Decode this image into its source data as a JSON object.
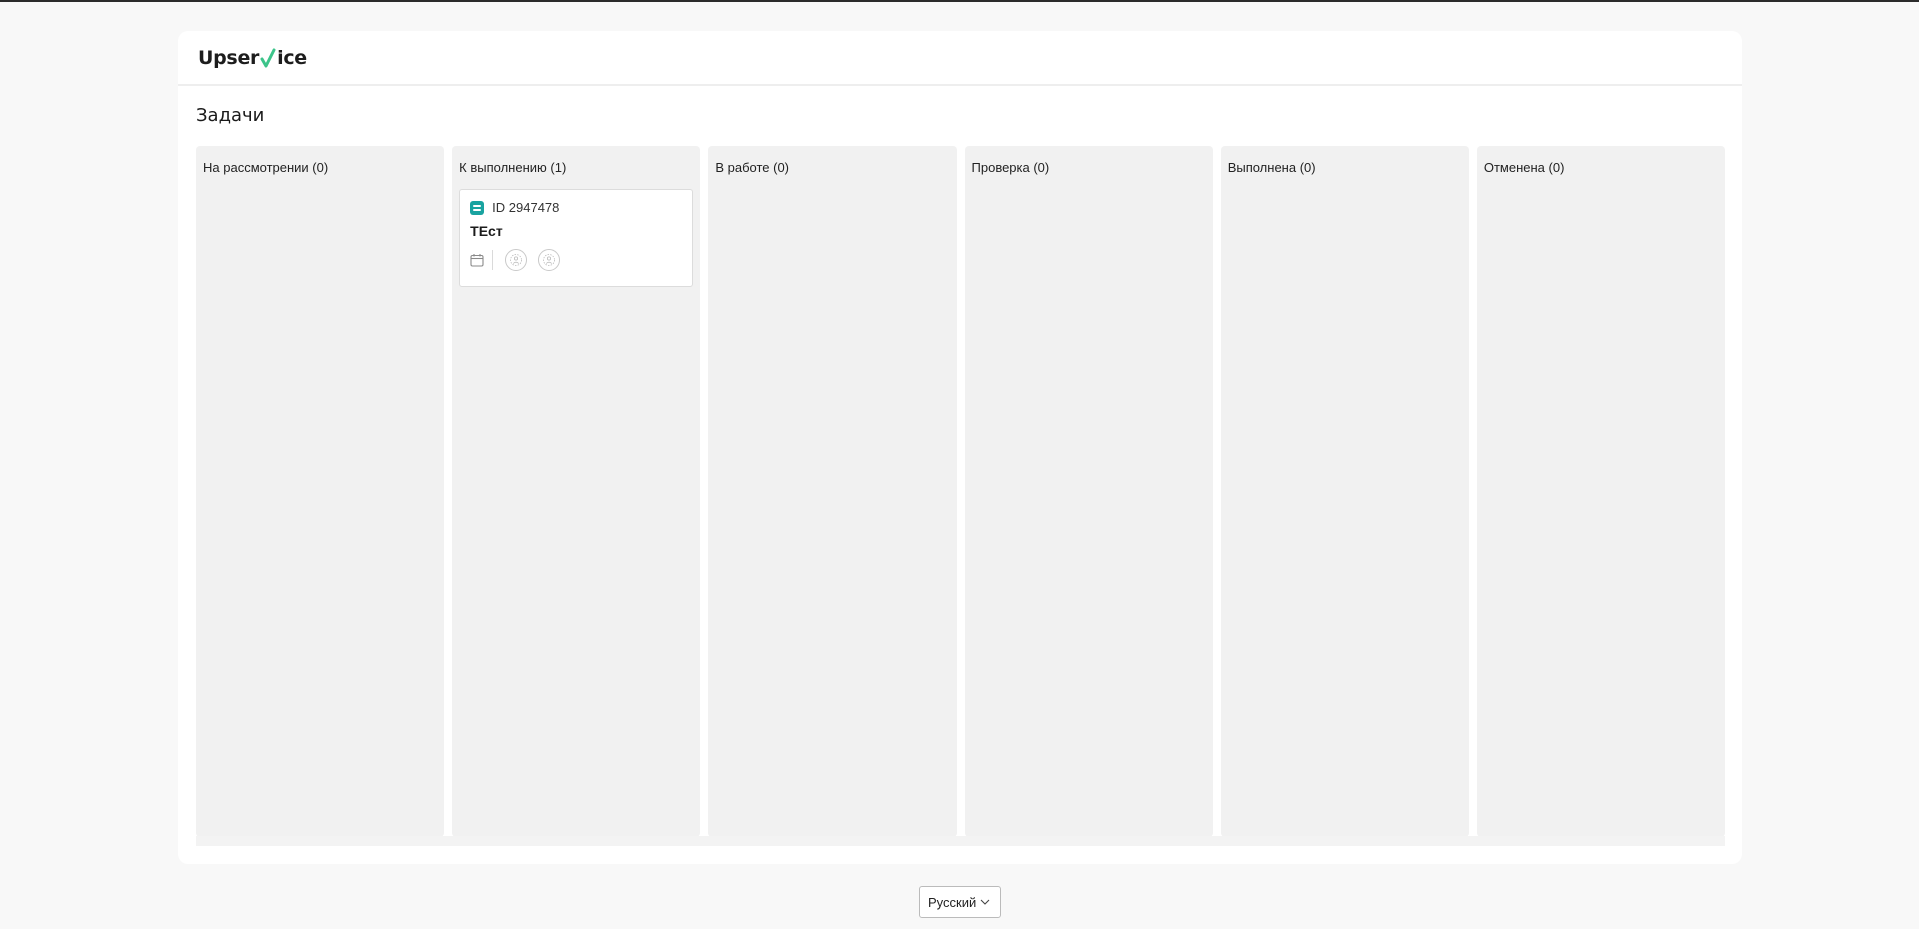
{
  "logo": {
    "part1": "Upser",
    "part2": "ice",
    "tick_color": "#3cc48a"
  },
  "page": {
    "title": "Задачи"
  },
  "columns": [
    {
      "title": "На рассмотрении (0)"
    },
    {
      "title": "К выполнению (1)"
    },
    {
      "title": "В работе (0)"
    },
    {
      "title": "Проверка (0)"
    },
    {
      "title": "Выполнена (0)"
    },
    {
      "title": "Отменена (0)"
    }
  ],
  "task": {
    "id_label": "ID 2947478",
    "title": "ТЕст",
    "type_icon": "task-list-icon",
    "date_icon": "calendar-icon",
    "assignees": [
      "avatar-placeholder-icon",
      "avatar-placeholder-icon"
    ]
  },
  "footer": {
    "language": "Русский"
  },
  "colors": {
    "accent": "#19a3a0",
    "column_bg": "#f1f1f1",
    "page_bg": "#f8f8f8"
  }
}
